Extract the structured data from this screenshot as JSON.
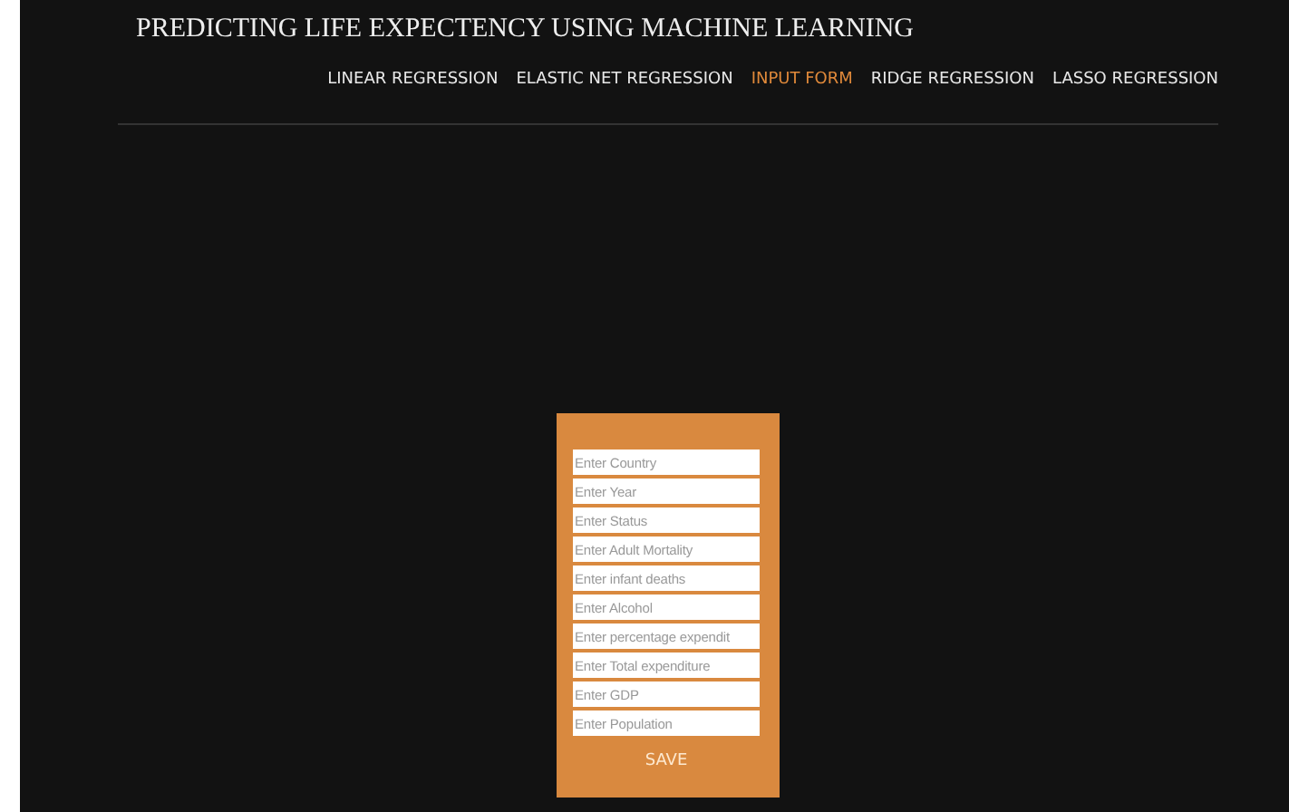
{
  "title": "PREDICTING LIFE EXPECTENCY USING MACHINE LEARNING",
  "nav": [
    {
      "label": "LINEAR REGRESSION",
      "selected": false
    },
    {
      "label": "ELASTIC NET REGRESSION",
      "selected": false
    },
    {
      "label": "INPUT FORM",
      "selected": true
    },
    {
      "label": "RIDGE REGRESSION",
      "selected": false
    },
    {
      "label": "LASSO REGRESSION",
      "selected": false
    }
  ],
  "form": {
    "fields": [
      {
        "placeholder": "Enter Country"
      },
      {
        "placeholder": "Enter Year"
      },
      {
        "placeholder": "Enter Status"
      },
      {
        "placeholder": "Enter Adult Mortality"
      },
      {
        "placeholder": "Enter infant deaths"
      },
      {
        "placeholder": "Enter Alcohol"
      },
      {
        "placeholder": "Enter percentage expendit"
      },
      {
        "placeholder": "Enter Total expenditure"
      },
      {
        "placeholder": "Enter GDP"
      },
      {
        "placeholder": "Enter Population"
      }
    ],
    "button": "SAVE"
  }
}
